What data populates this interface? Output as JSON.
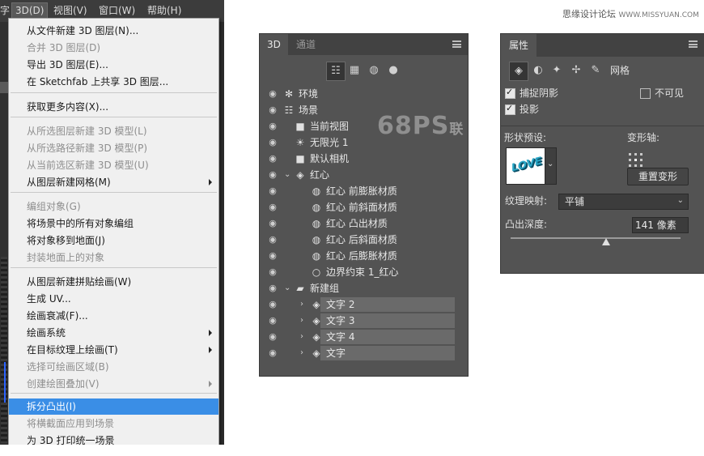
{
  "menubar": {
    "items": [
      {
        "label": "字",
        "active": false
      },
      {
        "label": "3D(D)",
        "active": true
      },
      {
        "label": "视图(V)",
        "active": false
      },
      {
        "label": "窗口(W)",
        "active": false
      },
      {
        "label": "帮助(H)",
        "active": false
      }
    ]
  },
  "menu": {
    "items": [
      {
        "label": "从文件新建 3D 图层(N)...",
        "disabled": false
      },
      {
        "label": "合并 3D 图层(D)",
        "disabled": true
      },
      {
        "label": "导出 3D 图层(E)...",
        "disabled": false
      },
      {
        "label": "在 Sketchfab 上共享 3D 图层...",
        "disabled": false
      },
      {
        "label": "获取更多内容(X)...",
        "disabled": false
      },
      {
        "label": "从所选图层新建 3D 模型(L)",
        "disabled": true
      },
      {
        "label": "从所选路径新建 3D 模型(P)",
        "disabled": true
      },
      {
        "label": "从当前选区新建 3D 模型(U)",
        "disabled": true
      },
      {
        "label": "从图层新建网格(M)",
        "disabled": false,
        "submenu": true
      },
      {
        "label": "编组对象(G)",
        "disabled": true
      },
      {
        "label": "将场景中的所有对象编组",
        "disabled": false
      },
      {
        "label": "将对象移到地面(J)",
        "disabled": false
      },
      {
        "label": "封装地面上的对象",
        "disabled": true
      },
      {
        "label": "从图层新建拼贴绘画(W)",
        "disabled": false
      },
      {
        "label": "生成 UV...",
        "disabled": false
      },
      {
        "label": "绘画衰减(F)...",
        "disabled": false
      },
      {
        "label": "绘画系统",
        "disabled": false,
        "submenu": true
      },
      {
        "label": "在目标纹理上绘画(T)",
        "disabled": false,
        "submenu": true
      },
      {
        "label": "选择可绘画区域(B)",
        "disabled": true
      },
      {
        "label": "创建绘图叠加(V)",
        "disabled": true,
        "submenu": true
      },
      {
        "label": "拆分凸出(I)",
        "disabled": false,
        "highlighted": true
      },
      {
        "label": "将横截面应用到场景",
        "disabled": true
      },
      {
        "label": "为 3D 打印统一场景",
        "disabled": false
      }
    ]
  },
  "panel3d": {
    "tabs": [
      "3D",
      "通道"
    ],
    "filter_icons": [
      "scene-filter-icon",
      "mesh-filter-icon",
      "material-filter-icon",
      "light-filter-icon"
    ],
    "rows": [
      {
        "label": "环境",
        "icon": "environment-icon",
        "glyph": "✻"
      },
      {
        "label": "场景",
        "icon": "scene-icon",
        "glyph": "☷"
      },
      {
        "label": "当前视图",
        "icon": "camera-icon",
        "glyph": "■"
      },
      {
        "label": "无限光 1",
        "icon": "light-icon",
        "glyph": "☀"
      },
      {
        "label": "默认相机",
        "icon": "camera-icon",
        "glyph": "■"
      },
      {
        "label": "红心",
        "icon": "mesh-icon",
        "glyph": "◈",
        "chevron": "⌄"
      },
      {
        "label": "红心 前膨胀材质",
        "icon": "material-icon",
        "glyph": "◍"
      },
      {
        "label": "红心 前斜面材质",
        "icon": "material-icon",
        "glyph": "◍"
      },
      {
        "label": "红心 凸出材质",
        "icon": "material-icon",
        "glyph": "◍"
      },
      {
        "label": "红心 后斜面材质",
        "icon": "material-icon",
        "glyph": "◍"
      },
      {
        "label": "红心 后膨胀材质",
        "icon": "material-icon",
        "glyph": "◍"
      },
      {
        "label": "边界约束 1_红心",
        "icon": "constraint-icon",
        "glyph": "○"
      },
      {
        "label": "新建组",
        "icon": "group-icon",
        "glyph": "▰",
        "chevron": "⌄"
      },
      {
        "label": "文字 2",
        "icon": "mesh-icon",
        "glyph": "◈",
        "chevron": "›",
        "selected": true
      },
      {
        "label": "文字 3",
        "icon": "mesh-icon",
        "glyph": "◈",
        "chevron": "›",
        "selected": true
      },
      {
        "label": "文字 4",
        "icon": "mesh-icon",
        "glyph": "◈",
        "chevron": "›",
        "selected": true
      },
      {
        "label": "文字",
        "icon": "mesh-icon",
        "glyph": "◈",
        "chevron": "›",
        "selected": true
      }
    ],
    "watermark": "68PS",
    "watermark_cn": "联"
  },
  "properties": {
    "tab": "属性",
    "mesh_label": "网格",
    "catch_shadow": "捕捉阴影",
    "invisible": "不可见",
    "cast_shadow": "投影",
    "shape_preset": "形状预设:",
    "shape_preview_text": "LOVE",
    "deform_axis": "变形轴:",
    "reset_button": "重置变形",
    "texture_mapping_label": "纹理映射:",
    "texture_mapping_value": "平铺",
    "extrusion_depth_label": "凸出深度:",
    "extrusion_depth_value": "141 像素",
    "extrusion_slider_fraction": 0.56
  },
  "site_watermark": {
    "text": "思缘设计论坛",
    "url": "WWW.MISSYUAN.COM"
  }
}
